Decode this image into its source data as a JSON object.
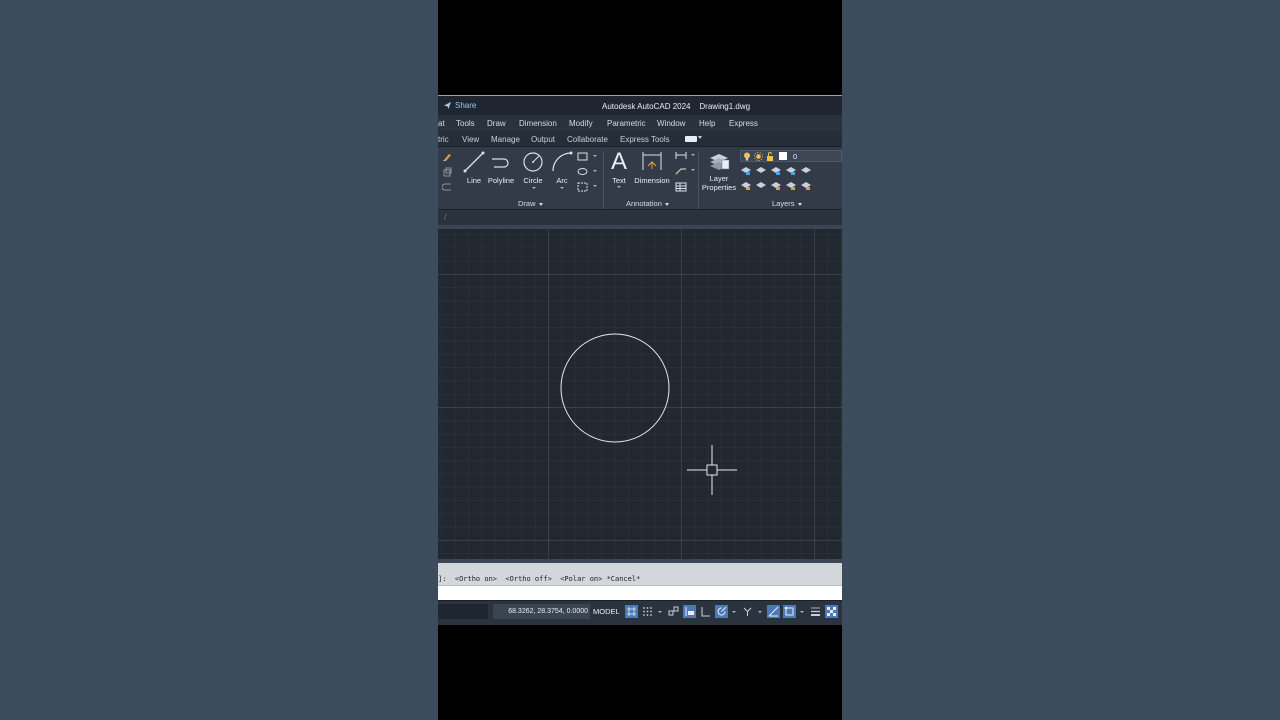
{
  "title_bar": {
    "share_label": "Share",
    "app_title": "Autodesk AutoCAD 2024    Drawing1.dwg"
  },
  "menu_bar": {
    "items": [
      "at",
      "Tools",
      "Draw",
      "Dimension",
      "Modify",
      "Parametric",
      "Window",
      "Help",
      "Express"
    ]
  },
  "ribbon_tabs": {
    "items": [
      "tric",
      "View",
      "Manage",
      "Output",
      "Collaborate",
      "Express Tools"
    ]
  },
  "ribbon": {
    "draw_panel": {
      "title": "Draw",
      "tools": [
        "Line",
        "Polyline",
        "Circle",
        "Arc"
      ]
    },
    "annotation_panel": {
      "title": "Annotation",
      "tools": [
        "Text",
        "Dimension"
      ]
    },
    "layers_panel": {
      "title": "Layers",
      "layer_properties_line1": "Layer",
      "layer_properties_line2": "Properties",
      "current_layer": "0"
    }
  },
  "canvas": {
    "objects": [
      {
        "type": "circle",
        "description": "drawn circle"
      }
    ],
    "cursor": "crosshair"
  },
  "command_line": {
    "history": "]:  <Ortho on>  <Ortho off>  <Polar on> *Cancel*",
    "input_value": ""
  },
  "status_bar": {
    "coordinates": "68.3262, 28.3754, 0.0000",
    "space": "MODEL"
  },
  "colors": {
    "accent": "#4e79b8",
    "canvas_background": "#212830",
    "page_background": "#3d4c5c"
  }
}
